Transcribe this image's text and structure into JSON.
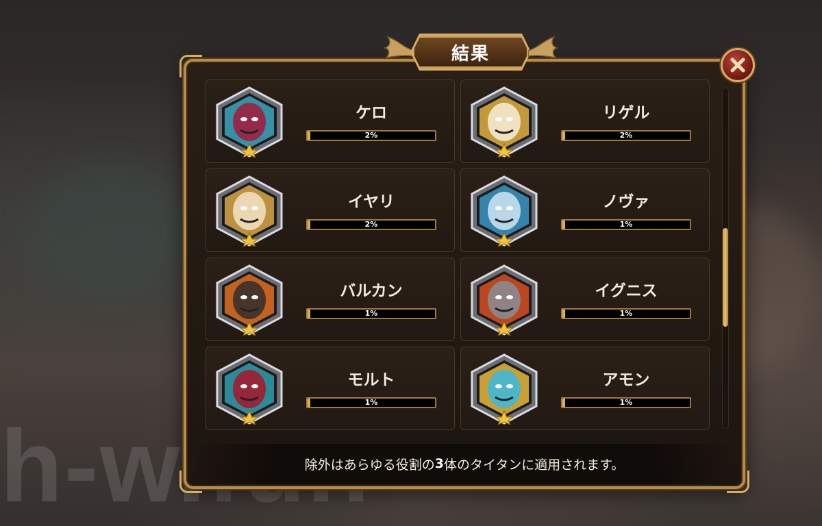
{
  "dialog": {
    "title": "結果",
    "close_icon": "close-x-icon",
    "footer": {
      "before": "除外はあらゆる役割の",
      "bold": "3",
      "after": "体のタイタンに適用されます。"
    }
  },
  "heroes": [
    {
      "name": "ケロ",
      "percent_label": "2%",
      "fill_fraction": 0.02,
      "theme": "#3aa8c0",
      "accent": "#a02040"
    },
    {
      "name": "リゲル",
      "percent_label": "2%",
      "fill_fraction": 0.02,
      "theme": "#e0b040",
      "accent": "#f5ead0"
    },
    {
      "name": "イヤリ",
      "percent_label": "2%",
      "fill_fraction": 0.02,
      "theme": "#d8a848",
      "accent": "#f0e0c0"
    },
    {
      "name": "ノヴァ",
      "percent_label": "1%",
      "fill_fraction": 0.01,
      "theme": "#3a98c8",
      "accent": "#c8e0f0"
    },
    {
      "name": "バルカン",
      "percent_label": "1%",
      "fill_fraction": 0.01,
      "theme": "#e07020",
      "accent": "#3a302c"
    },
    {
      "name": "イグニス",
      "percent_label": "1%",
      "fill_fraction": 0.01,
      "theme": "#d85020",
      "accent": "#8a8a90"
    },
    {
      "name": "モルト",
      "percent_label": "1%",
      "fill_fraction": 0.01,
      "theme": "#30a0b0",
      "accent": "#a01c30"
    },
    {
      "name": "アモン",
      "percent_label": "1%",
      "fill_fraction": 0.01,
      "theme": "#e8b838",
      "accent": "#40b8d8"
    }
  ],
  "scroll": {
    "position_fraction": 0.58,
    "visible_fraction": 0.29
  },
  "watermark": "h-w.fun",
  "colors": {
    "gold": "#d6ad62",
    "bar_fill": "#e0b048",
    "panel": "#1d1510"
  }
}
